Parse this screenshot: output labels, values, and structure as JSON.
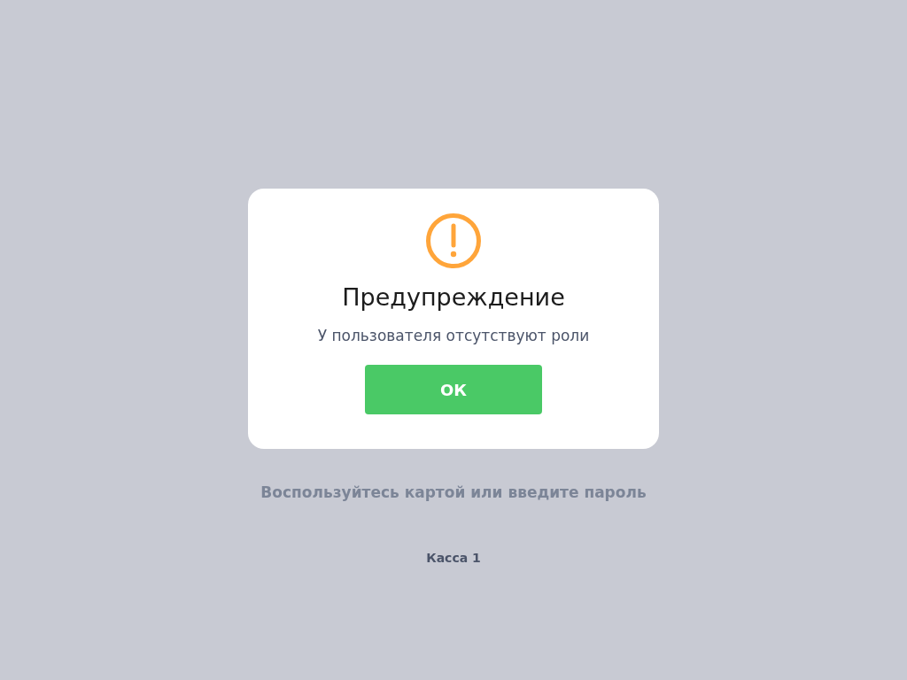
{
  "dialog": {
    "title": "Предупреждение",
    "message": "У пользователя отсутствуют роли",
    "button": "ОК"
  },
  "login": {
    "hint": "Воспользуйтесь картой или введите пароль",
    "terminal": "Касса 1"
  }
}
